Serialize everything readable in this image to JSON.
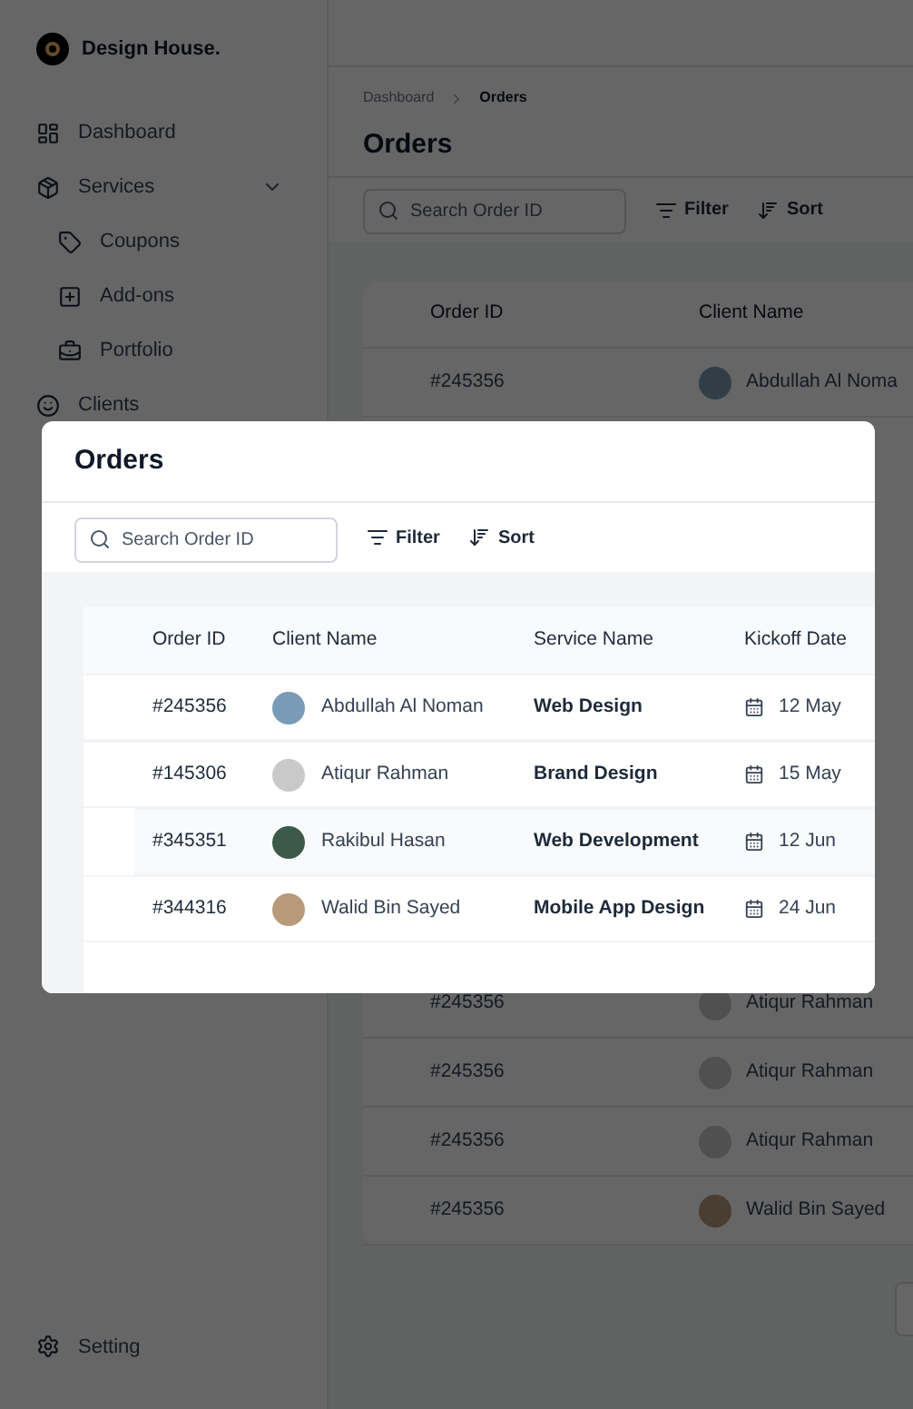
{
  "sidebar": {
    "brand": "Design House.",
    "items": [
      {
        "label": "Dashboard"
      },
      {
        "label": "Services",
        "expanded": true,
        "children": [
          {
            "label": "Coupons"
          },
          {
            "label": "Add-ons"
          },
          {
            "label": "Portfolio"
          }
        ]
      },
      {
        "label": "Clients"
      }
    ],
    "footer": {
      "label": "Setting"
    }
  },
  "page": {
    "breadcrumb": [
      "Dashboard",
      "Orders"
    ],
    "title": "Orders",
    "search": {
      "placeholder": "Search Order ID"
    },
    "filter": "Filter",
    "sort": "Sort",
    "table": {
      "columns": [
        "Order ID",
        "Client Name"
      ],
      "top_rows": [
        {
          "order_id": "#245356",
          "client": "Abdullah Al Noma"
        }
      ],
      "bottom_rows": [
        {
          "order_id": "#245356",
          "client": "Atiqur Rahman"
        },
        {
          "order_id": "#245356",
          "client": "Atiqur Rahman"
        },
        {
          "order_id": "#245356",
          "client": "Atiqur Rahman"
        },
        {
          "order_id": "#245356",
          "client": "Walid Bin Sayed"
        }
      ]
    }
  },
  "modal": {
    "title": "Orders",
    "search": {
      "placeholder": "Search Order ID"
    },
    "filter": "Filter",
    "sort": "Sort",
    "table": {
      "columns": [
        "Order ID",
        "Client Name",
        "Service Name",
        "Kickoff Date"
      ],
      "rows": [
        {
          "order_id": "#245356",
          "client": "Abdullah Al Noman",
          "service": "Web Design",
          "kickoff": "12 May",
          "selected": false
        },
        {
          "order_id": "#145306",
          "client": "Atiqur Rahman",
          "service": "Brand Design",
          "kickoff": "15 May",
          "selected": false
        },
        {
          "order_id": "#345351",
          "client": "Rakibul Hasan",
          "service": "Web Development",
          "kickoff": "12 Jun",
          "selected": true
        },
        {
          "order_id": "#344316",
          "client": "Walid Bin Sayed",
          "service": "Mobile App Design",
          "kickoff": "24 Jun",
          "selected": false
        }
      ]
    }
  }
}
